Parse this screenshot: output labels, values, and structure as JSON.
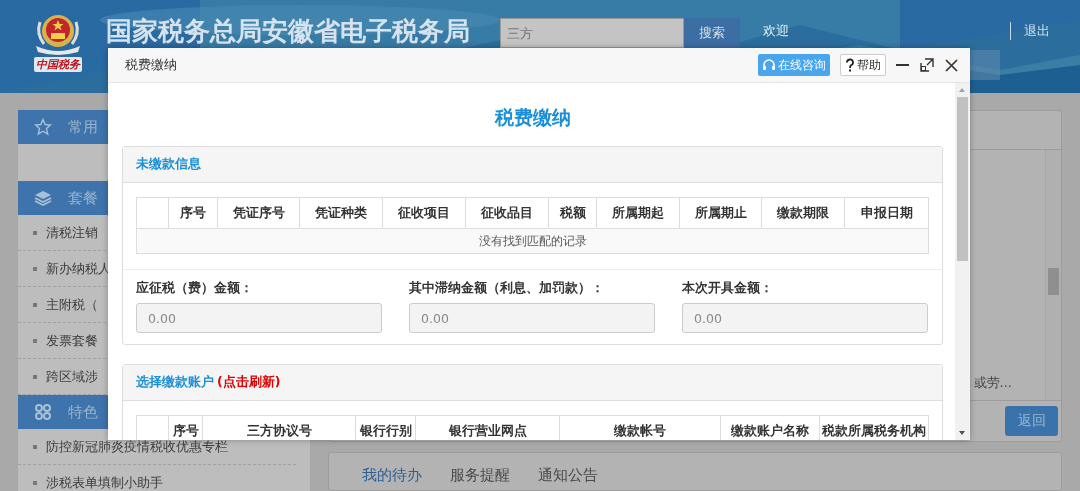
{
  "header": {
    "logo_text": "中国税务",
    "title": "国家税务总局安徽省电子税务局",
    "search": {
      "placeholder": "三方"
    },
    "search_button": "搜索",
    "welcome": "欢迎",
    "logout": "退出"
  },
  "sidebar": {
    "groups": [
      {
        "title": "常用"
      },
      {
        "title": "套餐",
        "items": [
          {
            "label": "清税注销"
          },
          {
            "label": "新办纳税人"
          },
          {
            "label": "主附税（"
          },
          {
            "label": "发票套餐"
          },
          {
            "label": "跨区域涉"
          }
        ]
      },
      {
        "title": "特色",
        "items": [
          {
            "label": "防控新冠肺炎疫情税收优惠专栏"
          },
          {
            "label": "涉税表单填制小助手"
          }
        ]
      }
    ]
  },
  "main": {
    "snippet": "或劳...",
    "back_button": "返回",
    "tabs": [
      {
        "label": "我的待办",
        "selected": true
      },
      {
        "label": "服务提醒",
        "selected": false
      },
      {
        "label": "通知公告",
        "selected": false
      }
    ]
  },
  "dialog": {
    "title": "税费缴纳",
    "consult_button": "在线咨询",
    "help_button": "帮助",
    "heading": "税费缴纳",
    "panels": [
      {
        "title": "未缴款信息",
        "columns": [
          "",
          "序号",
          "凭证序号",
          "凭证种类",
          "征收项目",
          "征收品目",
          "税额",
          "所属期起",
          "所属期止",
          "缴款期限",
          "申报日期"
        ],
        "empty_message": "没有找到匹配的记录",
        "fields": [
          {
            "label": "应征税（费）金额：",
            "value": "0.00",
            "disabled": true
          },
          {
            "label": "其中滞纳金额（利息、加罚款）：",
            "value": "0.00",
            "disabled": true
          },
          {
            "label": "本次开具金额：",
            "value": "0.00",
            "disabled": true
          }
        ]
      },
      {
        "title": "选择缴款账户",
        "note": "(点击刷新)",
        "columns": [
          "",
          "序号",
          "三方协议号",
          "银行行别",
          "银行营业网点",
          "缴款帐号",
          "缴款账户名称",
          "税款所属税务机构"
        ]
      }
    ]
  }
}
